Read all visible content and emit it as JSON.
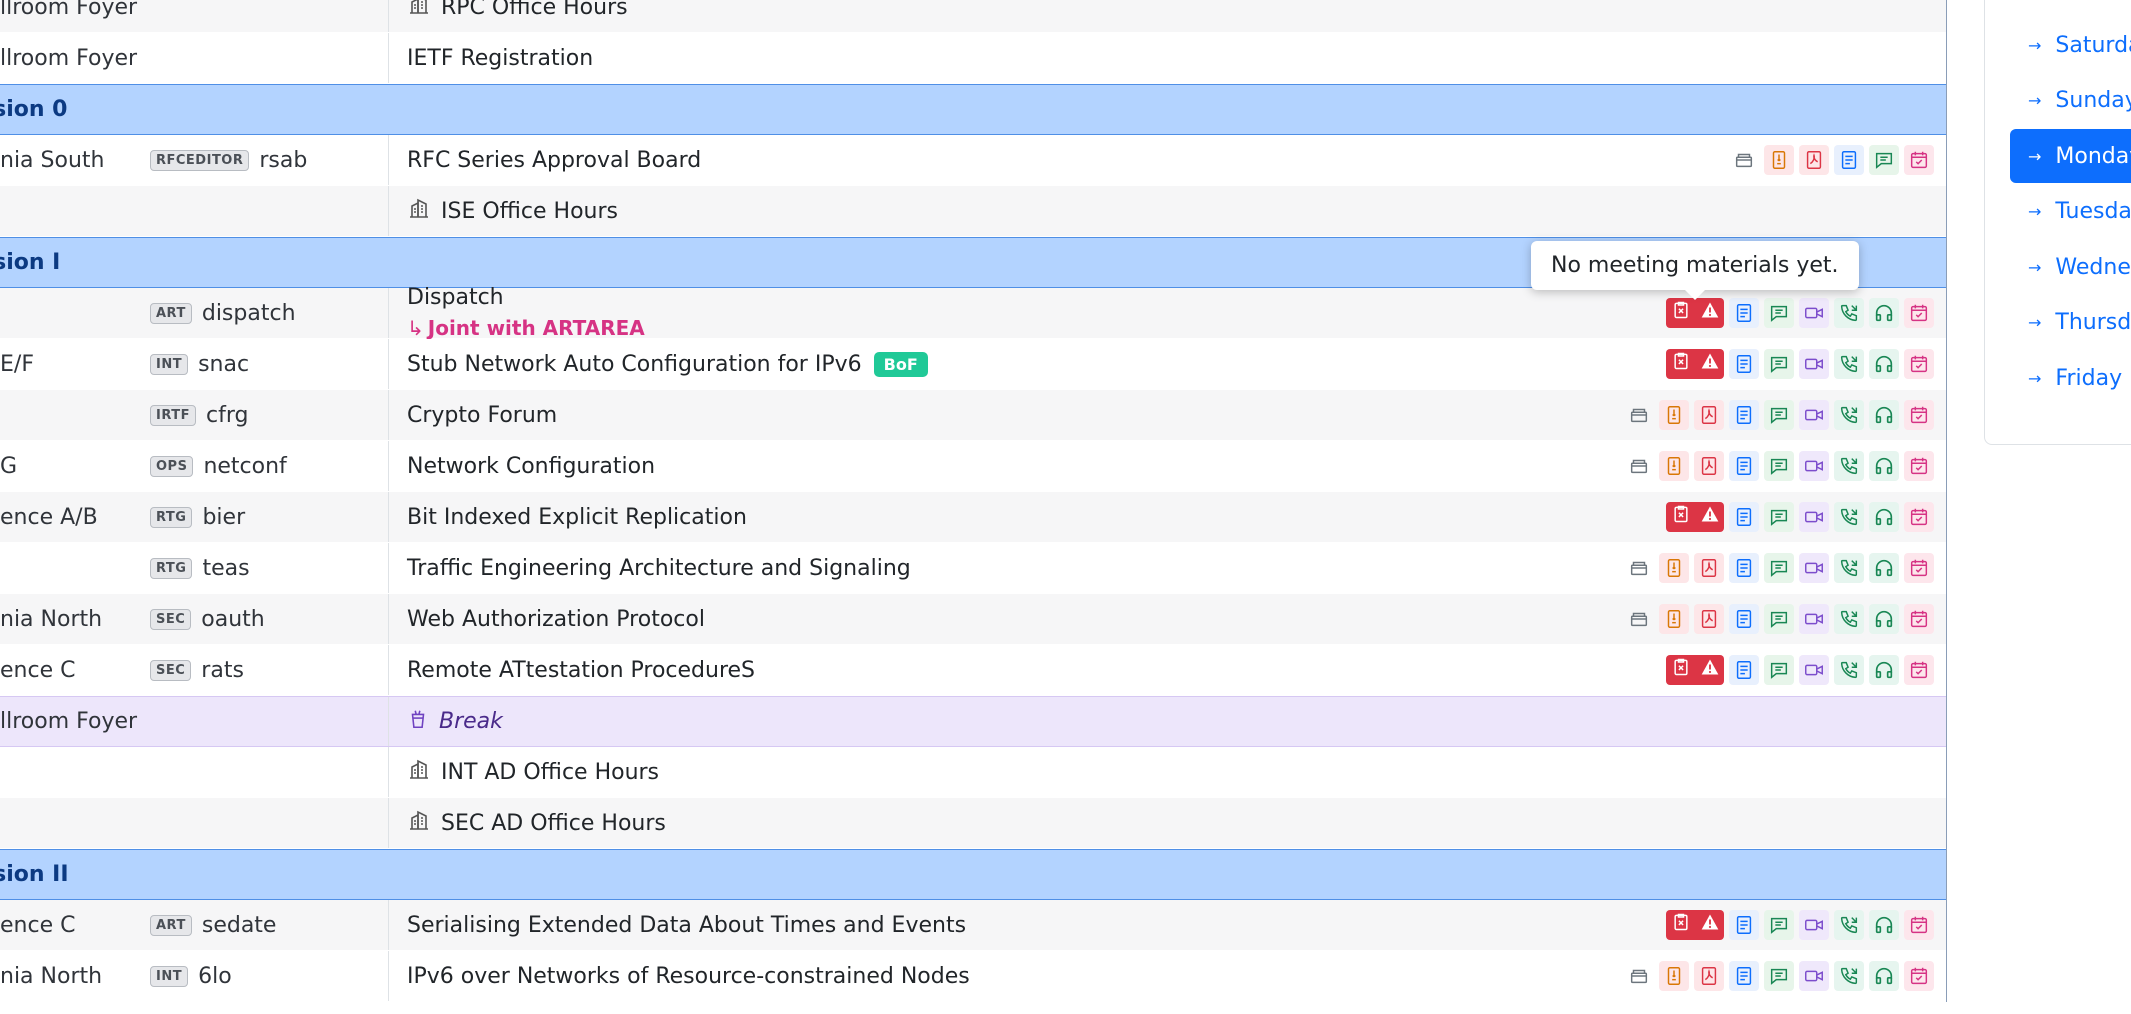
{
  "tooltip": "No meeting materials yet.",
  "nav": {
    "items": [
      {
        "label": "Saturday",
        "active": false
      },
      {
        "label": "Sunday",
        "active": false
      },
      {
        "label": "Monday",
        "active": true
      },
      {
        "label": "Tuesday",
        "active": false
      },
      {
        "label": "Wednesday",
        "active": false
      },
      {
        "label": "Thursday",
        "active": false
      },
      {
        "label": "Friday",
        "active": false
      }
    ]
  },
  "rows": [
    {
      "type": "item",
      "room": "llroom Foyer",
      "group": "",
      "area": "",
      "title": "RPC Office Hours",
      "oh": true,
      "icons": "none"
    },
    {
      "type": "item",
      "room": "llroom Foyer",
      "group": "",
      "area": "",
      "title": "IETF Registration",
      "oh": false,
      "icons": "none"
    },
    {
      "type": "session",
      "title": "ssion 0"
    },
    {
      "type": "item",
      "room": "nia South",
      "area": "RFCEDITOR",
      "group": "rsab",
      "title": "RFC Series Approval Board",
      "icons": "min"
    },
    {
      "type": "item",
      "room": "",
      "group": "",
      "area": "",
      "title": "ISE Office Hours",
      "oh": true,
      "icons": "none"
    },
    {
      "type": "session",
      "title": "ssion I"
    },
    {
      "type": "item",
      "room": "",
      "area": "ART",
      "group": "dispatch",
      "title": "Dispatch",
      "joint": "Joint with ARTAREA",
      "icons": "nomat"
    },
    {
      "type": "item",
      "room": "E/F",
      "area": "INT",
      "group": "snac",
      "title": "Stub Network Auto Configuration for IPv6",
      "bof": "BoF",
      "icons": "nomat"
    },
    {
      "type": "item",
      "room": "",
      "area": "IRTF",
      "group": "cfrg",
      "title": "Crypto Forum",
      "icons": "full"
    },
    {
      "type": "item",
      "room": "G",
      "area": "OPS",
      "group": "netconf",
      "title": "Network Configuration",
      "icons": "full"
    },
    {
      "type": "item",
      "room": "ence A/B",
      "area": "RTG",
      "group": "bier",
      "title": "Bit Indexed Explicit Replication",
      "icons": "nomat"
    },
    {
      "type": "item",
      "room": "",
      "area": "RTG",
      "group": "teas",
      "title": "Traffic Engineering Architecture and Signaling",
      "icons": "full"
    },
    {
      "type": "item",
      "room": "nia North",
      "area": "SEC",
      "group": "oauth",
      "title": "Web Authorization Protocol",
      "icons": "full"
    },
    {
      "type": "item",
      "room": "ence C",
      "area": "SEC",
      "group": "rats",
      "title": "Remote ATtestation ProcedureS",
      "icons": "nomat"
    },
    {
      "type": "break",
      "room": "llroom Foyer",
      "title": "Break"
    },
    {
      "type": "item",
      "room": "",
      "group": "",
      "area": "",
      "title": "INT AD Office Hours",
      "oh": true,
      "icons": "none"
    },
    {
      "type": "item",
      "room": "",
      "group": "",
      "area": "",
      "title": "SEC AD Office Hours",
      "oh": true,
      "icons": "none"
    },
    {
      "type": "session",
      "title": "ssion II"
    },
    {
      "type": "item",
      "room": "ence C",
      "area": "ART",
      "group": "sedate",
      "title": "Serialising Extended Data About Times and Events",
      "icons": "nomat"
    },
    {
      "type": "item",
      "room": "nia North",
      "area": "INT",
      "group": "6lo",
      "title": "IPv6 over Networks of Resource-constrained Nodes",
      "icons": "full"
    }
  ],
  "colors": {
    "session_bg": "#b3d3ff",
    "session_text": "#0c3a82",
    "break_bg": "#ede6fb",
    "accent": "#0d6efd",
    "no_materials": "#dc3545",
    "joint": "#d63384",
    "bof": "#20c997"
  },
  "icon_names": [
    "tarball-icon",
    "draft-icon",
    "pdf-icon",
    "minutes-icon",
    "chat-icon",
    "video-icon",
    "phone-icon",
    "audio-icon",
    "calendar-icon",
    "no-materials-icon",
    "warning-icon",
    "office-hours-icon",
    "break-cup-icon"
  ]
}
